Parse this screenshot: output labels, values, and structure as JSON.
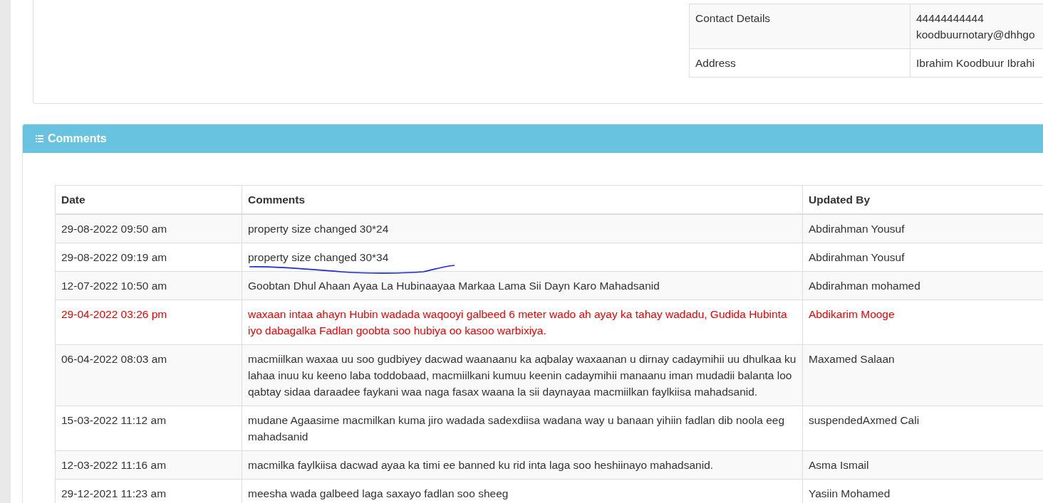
{
  "details_table": {
    "rows": [
      {
        "label": "Contact Details",
        "values": [
          "44444444444",
          "koodbuurnotary@dhhgo"
        ]
      },
      {
        "label": "Address",
        "values": [
          "Ibrahim Koodbuur Ibrahi"
        ]
      }
    ]
  },
  "comments_panel": {
    "title": "Comments",
    "table": {
      "columns": [
        "Date",
        "Comments",
        "Updated By"
      ],
      "rows": [
        {
          "date": "29-08-2022 09:50 am",
          "comment": "property size changed 30*24",
          "updated_by": "Abdirahman Yousuf",
          "alert": false,
          "underlined": false
        },
        {
          "date": "29-08-2022 09:19 am",
          "comment": "property size changed 30*34",
          "updated_by": "Abdirahman Yousuf",
          "alert": false,
          "underlined": true
        },
        {
          "date": "12-07-2022 10:50 am",
          "comment": "Goobtan Dhul Ahaan Ayaa La Hubinaayaa Markaa Lama Sii Dayn Karo Mahadsanid",
          "updated_by": "Abdirahman mohamed",
          "alert": false,
          "underlined": false
        },
        {
          "date": "29-04-2022 03:26 pm",
          "comment": "waxaan intaa ahayn Hubin wadada waqooyi galbeed 6 meter wado ah ayay ka tahay wadadu, Gudida Hubinta iyo dabagalka Fadlan goobta soo hubiya oo kasoo warbixiya.",
          "updated_by": "Abdikarim Mooge",
          "alert": true,
          "underlined": false
        },
        {
          "date": "06-04-2022 08:03 am",
          "comment": "macmiilkan waxaa uu soo gudbiyey dacwad waanaanu ka aqbalay waxaanan u dirnay cadaymihii uu dhulkaa ku lahaa inuu ku keeno laba toddobaad, macmiilkani kumuu keenin cadaymihii manaanu iman mudadii balanta loo qabtay sidaa daraadee faykani waa naga fasax waana la sii daynayaa macmiilkan faylkiisa mahadsanid.",
          "updated_by": "Maxamed Salaan",
          "alert": false,
          "underlined": false
        },
        {
          "date": "15-03-2022 11:12 am",
          "comment": "mudane Agaasime macmilkan kuma jiro wadada sadexdiisa wadana way u banaan yihiin fadlan dib noola eeg mahadsanid",
          "updated_by": "suspendedAxmed Cali",
          "alert": false,
          "underlined": false
        },
        {
          "date": "12-03-2022 11:16 am",
          "comment": "macmilka faylkiisa dacwad ayaa ka timi ee banned ku rid inta laga soo heshiinayo mahadsanid.",
          "updated_by": "Asma Ismail",
          "alert": false,
          "underlined": false
        },
        {
          "date": "29-12-2021 11:23 am",
          "comment": "meesha wada galbeed laga saxayo fadlan soo sheeg",
          "updated_by": "Yasiin Mohamed",
          "alert": false,
          "underlined": false
        }
      ]
    }
  }
}
